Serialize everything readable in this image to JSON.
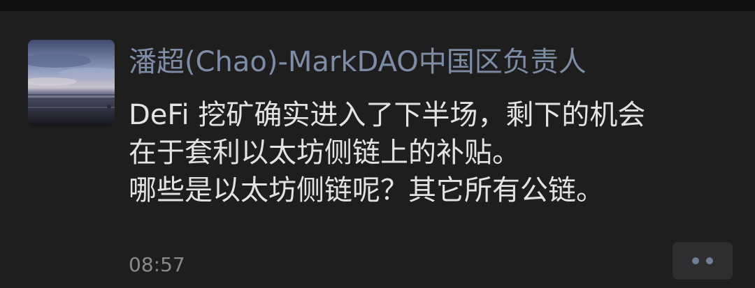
{
  "post": {
    "author_name": "潘超(Chao)-MarkDAO中国区负责人",
    "content_lines": [
      "DeFi 挖矿确实进入了下半场，剩下的机会",
      "在于套利以太坊侧链上的补贴。",
      "哪些是以太坊侧链呢？其它所有公链。"
    ],
    "timestamp": "08:57"
  },
  "actions": {
    "more_icon": "ellipsis-icon"
  },
  "colors": {
    "background": "#1e1e1e",
    "author_name": "#7d8da6",
    "content_text": "#e3e3e3",
    "timestamp": "#8a8a8a",
    "more_button_bg": "#2e2e30",
    "more_dots": "#6f7f98"
  }
}
